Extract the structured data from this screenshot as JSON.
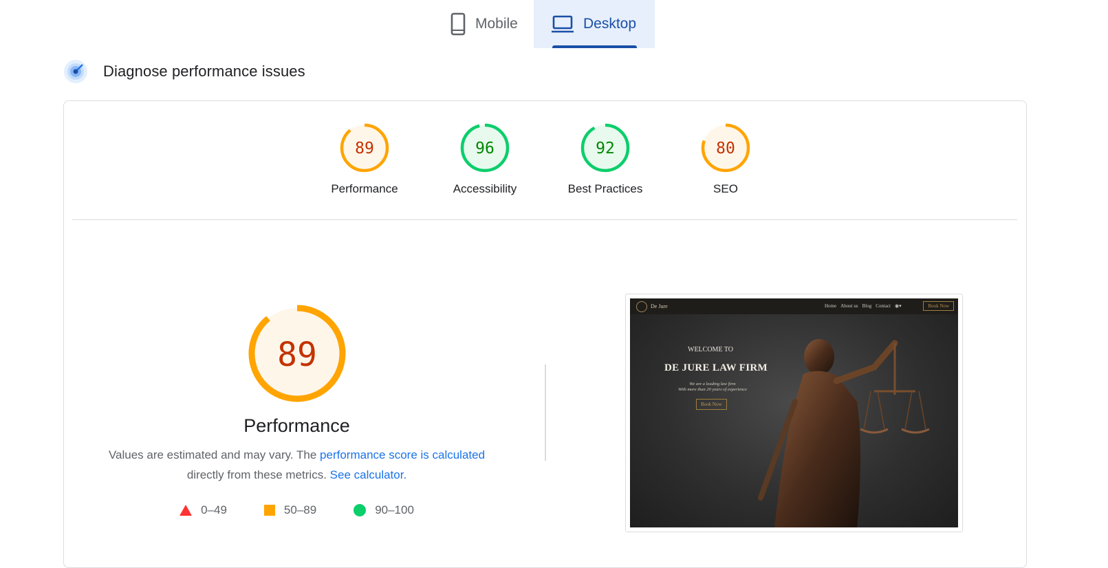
{
  "tabs": [
    {
      "label": "Mobile",
      "icon": "phone-icon",
      "active": false
    },
    {
      "label": "Desktop",
      "icon": "laptop-icon",
      "active": true
    }
  ],
  "diagnose": {
    "title": "Diagnose performance issues",
    "icon": "diagnose-icon"
  },
  "scores": [
    {
      "label": "Performance",
      "value": "89",
      "score": 0.89,
      "color": "#ffa400",
      "text_color": "#c33300",
      "fill": "#fff6ea"
    },
    {
      "label": "Accessibility",
      "value": "96",
      "score": 0.96,
      "color": "#0cce6b",
      "text_color": "#008800",
      "fill": "#e8f9ee"
    },
    {
      "label": "Best Practices",
      "value": "92",
      "score": 0.92,
      "color": "#0cce6b",
      "text_color": "#008800",
      "fill": "#e8f9ee"
    },
    {
      "label": "SEO",
      "value": "80",
      "score": 0.8,
      "color": "#ffa400",
      "text_color": "#c33300",
      "fill": "#fff6ea"
    }
  ],
  "performance": {
    "value": "89",
    "score": 0.89,
    "title": "Performance",
    "desc_prefix": "Values are estimated and may vary. The ",
    "desc_link": "performance score is calculated",
    "desc_middle": "directly from these metrics. ",
    "calc_link": "See calculator.",
    "legend": [
      {
        "label": "0–49",
        "shape": "triangle",
        "color": "#ff3333"
      },
      {
        "label": "50–89",
        "shape": "square",
        "color": "#ffa400"
      },
      {
        "label": "90–100",
        "shape": "circle",
        "color": "#0cce6b"
      }
    ]
  },
  "site_preview": {
    "brand": "De Jure",
    "nav": [
      "Home",
      "About us",
      "Blog",
      "Contact"
    ],
    "book": "Book Now",
    "welcome": "WELCOME TO",
    "heading": "DE JURE LAW FIRM",
    "sub_line1": "We are a leading law firm",
    "sub_line2": "With more than 20 years of experience",
    "cta": "Book Now"
  }
}
